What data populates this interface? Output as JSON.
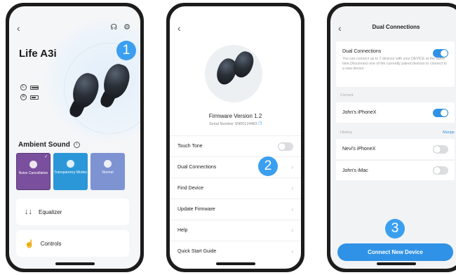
{
  "colors": {
    "accent": "#2f92e6",
    "badge": "#3b9ff0",
    "noise_cancel": "#7a4f9d",
    "transparency": "#2b97d8",
    "normal": "#7d93d2"
  },
  "screen1": {
    "back_icon": "chevron-left-icon",
    "device_name": "Life A3i",
    "ambient_title": "Ambient Sound",
    "modes": [
      {
        "label": "Noise Cancellation",
        "selected": true
      },
      {
        "label": "Transparency Modes",
        "selected": false
      },
      {
        "label": "Normal",
        "selected": false
      }
    ],
    "equalizer_label": "Equalizer",
    "controls_label": "Controls",
    "badge": "1"
  },
  "screen2": {
    "firmware": "Firmware Version 1.2",
    "serial": "Serial Number SN00124483",
    "menu": [
      {
        "label": "Touch Tone",
        "type": "toggle",
        "on": false
      },
      {
        "label": "Dual Connections",
        "type": "link"
      },
      {
        "label": "Find Device",
        "type": "link"
      },
      {
        "label": "Update Firmware",
        "type": "link"
      },
      {
        "label": "Help",
        "type": "link"
      },
      {
        "label": "Quick Start Guide",
        "type": "link"
      }
    ],
    "badge": "2"
  },
  "screen3": {
    "title": "Dual Connections",
    "dual_label": "Dual Connections",
    "dual_on": true,
    "dual_desc": "You can connect up to 2 devices with your DEVICE at the same time.Disconnect one of the currently paired devices to connect to a new device.",
    "current_label": "Current",
    "current_device": "John's iPhoneX",
    "current_on": true,
    "history_label": "History",
    "manage_label": "Mange",
    "history": [
      {
        "name": "Nevi's iPhoneX",
        "on": false
      },
      {
        "name": "John's iMac",
        "on": false
      }
    ],
    "connect_button": "Connect New Device",
    "badge": "3"
  }
}
